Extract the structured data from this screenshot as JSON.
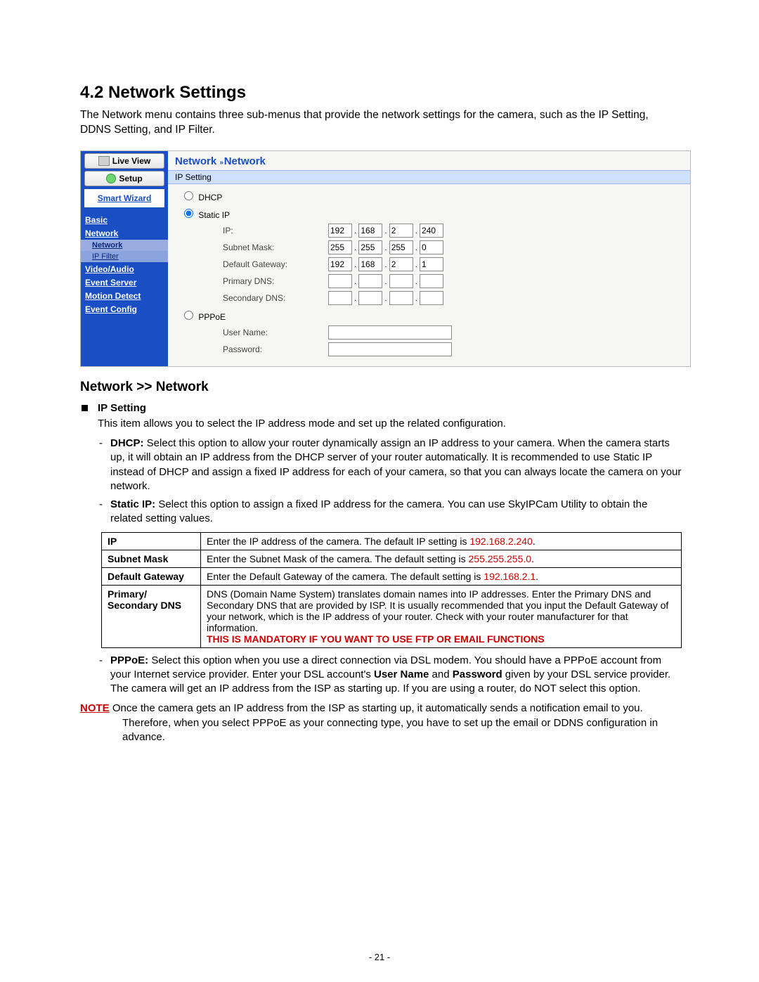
{
  "heading": "4.2  Network Settings",
  "intro": "The Network menu contains three sub-menus that provide the network settings for the camera, such as the IP Setting, DDNS Setting, and IP Filter.",
  "ui": {
    "sidebar": {
      "live_view": "Live View",
      "setup": "Setup",
      "smart_wizard": "Smart Wizard",
      "items": [
        "Basic",
        "Network",
        "Video/Audio",
        "Event Server",
        "Motion Detect",
        "Event Config"
      ],
      "network_sub": [
        "Network",
        "IP Filter"
      ]
    },
    "breadcrumb": {
      "a": "Network",
      "b": "Network"
    },
    "section_title": "IP Setting",
    "radios": {
      "dhcp": "DHCP",
      "static": "Static IP",
      "pppoe": "PPPoE"
    },
    "labels": {
      "ip": "IP:",
      "subnet": "Subnet Mask:",
      "gateway": "Default Gateway:",
      "pdns": "Primary DNS:",
      "sdns": "Secondary DNS:",
      "user": "User Name:",
      "pass": "Password:"
    },
    "values": {
      "ip": [
        "192",
        "168",
        "2",
        "240"
      ],
      "subnet": [
        "255",
        "255",
        "255",
        "0"
      ],
      "gateway": [
        "192",
        "168",
        "2",
        "1"
      ],
      "pdns": [
        "",
        "",
        "",
        ""
      ],
      "sdns": [
        "",
        "",
        "",
        ""
      ]
    }
  },
  "subhead": "Network >> Network",
  "ipsetting_title": "IP Setting",
  "ipsetting_desc": "This item allows you to select the IP address mode and set up the related configuration.",
  "dhcp": {
    "label": "DHCP:",
    "text": " Select this option to allow your router dynamically assign an IP address to your camera. When the camera starts up, it will obtain an IP address from the DHCP server of your router automatically.  It is recommended to use Static IP instead of DHCP and assign a fixed IP address for each of your camera, so that you can always locate the camera on your network."
  },
  "static": {
    "label": "Static IP:",
    "text": " Select this option to assign a fixed IP address for the camera. You can use SkyIPCam Utility to obtain the related setting values."
  },
  "table": {
    "rows": [
      {
        "k": "IP",
        "v_pre": "Enter the IP address of the camera. The default IP setting is ",
        "v_red": "192.168.2.240",
        "v_post": "."
      },
      {
        "k": "Subnet Mask",
        "v_pre": "Enter the Subnet Mask of the camera. The default setting is ",
        "v_red": "255.255.255.0",
        "v_post": "."
      },
      {
        "k": "Default Gateway",
        "v_pre": "Enter the Default Gateway of the camera. The default setting is ",
        "v_red": "192.168.2.1",
        "v_post": "."
      }
    ],
    "dns": {
      "k": "Primary/ Secondary DNS",
      "v": "DNS (Domain Name System) translates domain names into IP addresses. Enter the Primary DNS and Secondary DNS that are provided by ISP.  It is usually recommended that you input the Default Gateway of your network, which is the IP address of your router.  Check with your router manufacturer for that information.",
      "mandatory": "THIS IS MANDATORY IF YOU WANT TO USE FTP OR EMAIL FUNCTIONS"
    }
  },
  "pppoe": {
    "label": "PPPoE:",
    "t1": " Select this option when you use a direct connection via  DSL modem. You should have a PPPoE account from your Internet service provider. Enter your DSL account's ",
    "b1": "User Name",
    "t2": " and ",
    "b2": "Password",
    "t3": " given by your DSL service provider. The camera will get an IP address from the ISP as starting up.  If you are using a router, do NOT select this option."
  },
  "note": {
    "label": "NOTE",
    "text": " Once the camera gets an IP address from the ISP as starting up, it automatically sends a notification email to you. Therefore, when you select PPPoE as your connecting type, you have to set up the email or DDNS configuration in advance."
  },
  "page_num": "- 21 -"
}
